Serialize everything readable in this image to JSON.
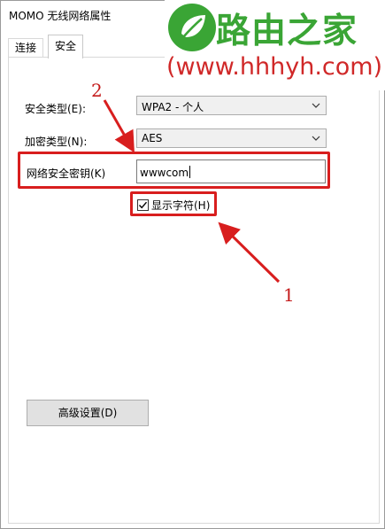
{
  "window": {
    "title": "MOMO 无线网络属性"
  },
  "tabs": [
    {
      "label": "连接"
    },
    {
      "label": "安全"
    }
  ],
  "form": {
    "security_type_label": "安全类型(E):",
    "security_type_value": "WPA2 - 个人",
    "encryption_type_label": "加密类型(N):",
    "encryption_type_value": "AES",
    "key_label": "网络安全密钥(K)",
    "key_value": "wwwcom",
    "show_chars_label": "显示字符(H)",
    "show_chars_checked": true,
    "advanced_button": "高级设置(D)"
  },
  "annotations": {
    "callout_1": "1",
    "callout_2": "2",
    "color": "#d81e1e"
  },
  "watermark": {
    "name": "路由之家",
    "url": "(www.hhhyh.com)",
    "name_color": "#3aa535",
    "url_color": "#d02828",
    "icon": "leaf-logo-icon"
  }
}
